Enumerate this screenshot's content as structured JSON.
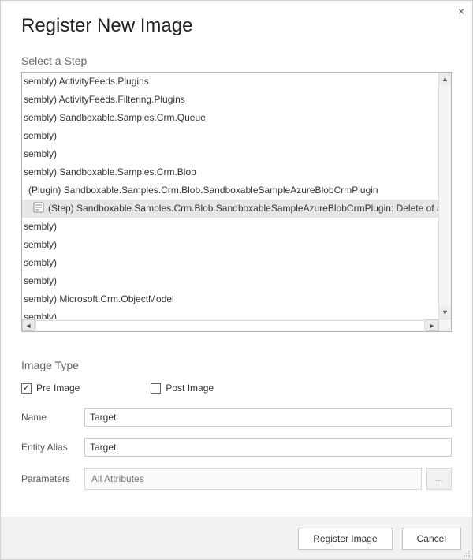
{
  "dialog": {
    "title": "Register New Image",
    "close_icon": "×"
  },
  "step": {
    "heading": "Select a Step",
    "items": [
      {
        "indent": 0,
        "prefix": "sembly)",
        "label": "ActivityFeeds.Plugins",
        "selected": false,
        "icon": null
      },
      {
        "indent": 0,
        "prefix": "sembly)",
        "label": "ActivityFeeds.Filtering.Plugins",
        "selected": false,
        "icon": null
      },
      {
        "indent": 0,
        "prefix": "sembly)",
        "label": "Sandboxable.Samples.Crm.Queue",
        "selected": false,
        "icon": null
      },
      {
        "indent": 0,
        "prefix": "sembly)",
        "label": "",
        "selected": false,
        "icon": null
      },
      {
        "indent": 0,
        "prefix": "sembly)",
        "label": "",
        "selected": false,
        "icon": null
      },
      {
        "indent": 0,
        "prefix": "sembly)",
        "label": "Sandboxable.Samples.Crm.Blob",
        "selected": false,
        "icon": null
      },
      {
        "indent": 1,
        "prefix": "(Plugin)",
        "label": "Sandboxable.Samples.Crm.Blob.SandboxableSampleAzureBlobCrmPlugin",
        "selected": false,
        "icon": null
      },
      {
        "indent": 2,
        "prefix": "(Step)",
        "label": "Sandboxable.Samples.Crm.Blob.SandboxableSampleAzureBlobCrmPlugin: Delete of  any E",
        "selected": true,
        "icon": "step"
      },
      {
        "indent": 0,
        "prefix": "sembly)",
        "label": "",
        "selected": false,
        "icon": null
      },
      {
        "indent": 0,
        "prefix": "sembly)",
        "label": "",
        "selected": false,
        "icon": null
      },
      {
        "indent": 0,
        "prefix": "sembly)",
        "label": "",
        "selected": false,
        "icon": null
      },
      {
        "indent": 0,
        "prefix": "sembly)",
        "label": "",
        "selected": false,
        "icon": null
      },
      {
        "indent": 0,
        "prefix": "sembly)",
        "label": "Microsoft.Crm.ObjectModel",
        "selected": false,
        "icon": null
      },
      {
        "indent": 0,
        "prefix": "sembly)",
        "label": "",
        "selected": false,
        "icon": null
      }
    ]
  },
  "image_type": {
    "heading": "Image Type",
    "pre_image_label": "Pre Image",
    "pre_image_checked": true,
    "post_image_label": "Post Image",
    "post_image_checked": false
  },
  "form": {
    "name_label": "Name",
    "name_value": "Target",
    "entity_alias_label": "Entity Alias",
    "entity_alias_value": "Target",
    "parameters_label": "Parameters",
    "parameters_placeholder": "All Attributes",
    "parameters_button": "..."
  },
  "footer": {
    "register_label": "Register Image",
    "cancel_label": "Cancel"
  }
}
